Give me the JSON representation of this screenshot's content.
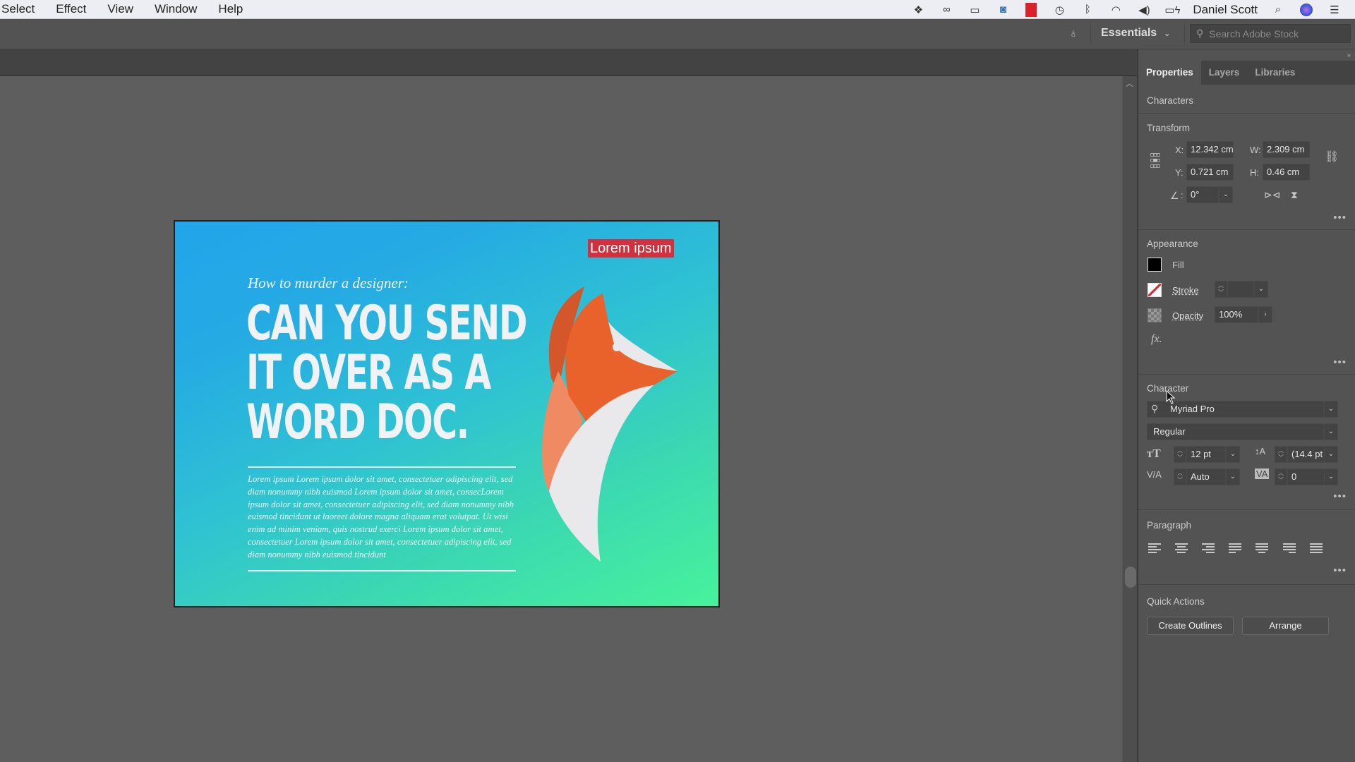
{
  "menubar": {
    "items": [
      "Select",
      "Effect",
      "View",
      "Window",
      "Help"
    ],
    "tray_icons": [
      "dropbox-icon",
      "creative-cloud-icon",
      "display-icon",
      "camera-icon",
      "film-icon",
      "time-machine-icon",
      "bluetooth-icon",
      "wifi-icon",
      "volume-icon",
      "battery-icon"
    ],
    "user_name": "Daniel Scott",
    "right_icons": [
      "spotlight-search-icon",
      "siri-icon",
      "notification-center-icon"
    ]
  },
  "appbar": {
    "workspace": "Essentials",
    "stock_search_placeholder": "Search Adobe Stock"
  },
  "artboard": {
    "subhead": "How to murder a designer:",
    "headline_lines": [
      "CAN YOU SEND",
      "IT OVER AS A",
      "WORD DOC."
    ],
    "body": "Lorem ipsum Lorem ipsum dolor sit amet, consectetuer adipiscing elit, sed diam nonummy nibh euismod Lorem ipsum dolor sit amet, consecLorem ipsum dolor sit amet, consectetuer adipiscing elit, sed diam nonummy nibh euismod tincidunt ut laoreet dolore magna aliquam erat volutpat. Ut wisi enim ad minim veniam, quis nostrud exerci Lorem ipsum dolor sit amet, consectetuer Lorem ipsum dolor sit amet, consectetuer adipiscing elit, sed diam nonummy nibh euismod tincidunt",
    "badge": "Lorem ipsum",
    "colors": {
      "gradient_start": "#22a5ea",
      "gradient_end": "#47f29b",
      "badge_bg": "#d42f3d",
      "fox_dark": "#d4572b",
      "fox_main": "#ea622b",
      "fox_light": "#f08a63",
      "fox_white": "#e9e9ec"
    }
  },
  "panel": {
    "tabs": [
      "Properties",
      "Layers",
      "Libraries"
    ],
    "active_tab": "Properties",
    "selection_type": "Characters",
    "transform": {
      "title": "Transform",
      "x_label": "X:",
      "x": "12.342 cm",
      "y_label": "Y:",
      "y": "0.721 cm",
      "w_label": "W:",
      "w": "2.309 cm",
      "h_label": "H:",
      "h": "0.46 cm",
      "angle_label": ":",
      "angle": "0°"
    },
    "appearance": {
      "title": "Appearance",
      "fill_label": "Fill",
      "stroke_label": "Stroke",
      "stroke_value": "",
      "opacity_label": "Opacity",
      "opacity": "100%",
      "fx_label": "fx."
    },
    "character": {
      "title": "Character",
      "font_family": "Myriad Pro",
      "font_style": "Regular",
      "font_size": "12 pt",
      "leading": "(14.4 pt",
      "kerning": "Auto",
      "tracking": "0"
    },
    "paragraph": {
      "title": "Paragraph",
      "align_buttons": [
        "align-left",
        "align-center",
        "align-right",
        "justify-last-left",
        "justify-last-center",
        "justify-last-right",
        "justify-all"
      ]
    },
    "quick_actions": {
      "title": "Quick Actions",
      "buttons": [
        "Create Outlines",
        "Arrange"
      ]
    }
  }
}
